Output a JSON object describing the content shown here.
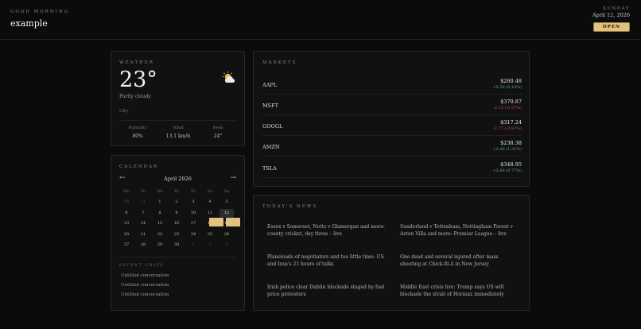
{
  "header": {
    "greeting": "GOOD MORNING",
    "name": "example",
    "day": "SUNDAY",
    "date": "April 12, 2026",
    "open_chat_label": "OPEN CHAT",
    "accent_color": "#e3c27d"
  },
  "weather": {
    "title": "WEATHER",
    "temperature": "23°",
    "condition": "Partly cloudy",
    "city": "City",
    "icon": "partly-cloudy-icon",
    "stats": [
      {
        "label": "Humidity",
        "value": "80%"
      },
      {
        "label": "Wind",
        "value": "13.1 km/h"
      },
      {
        "label": "Feels",
        "value": "24°"
      }
    ]
  },
  "calendar": {
    "title": "CALENDAR",
    "month": "April 2026",
    "prev_icon": "←",
    "next_icon": "→",
    "weekdays": [
      "Mo",
      "Tu",
      "We",
      "Th",
      "Fr",
      "Sa",
      "Su"
    ],
    "days": [
      [
        "30",
        "31",
        "1",
        "2",
        "3",
        "4",
        "5"
      ],
      [
        "6",
        "7",
        "8",
        "9",
        "10",
        "11",
        "12"
      ],
      [
        "13",
        "14",
        "15",
        "16",
        "17",
        "18",
        "19"
      ],
      [
        "20",
        "21",
        "22",
        "23",
        "24",
        "25",
        "26"
      ],
      [
        "27",
        "28",
        "29",
        "30",
        "1",
        "2",
        "3"
      ]
    ],
    "selected_day": "12",
    "event_days": [
      "11",
      "12"
    ],
    "recent_title": "RECENT CHATS",
    "recent_chats": [
      "Untitled conversation",
      "Untitled conversation",
      "Untitled conversation"
    ]
  },
  "markets": {
    "title": "MARKETS",
    "up_color": "#5cb66a",
    "down_color": "#d0544a",
    "stocks": [
      {
        "ticker": "AAPL",
        "price": "$260.48",
        "change": "+0.50 (0.19%)",
        "direction": "up"
      },
      {
        "ticker": "MSFT",
        "price": "$370.87",
        "change": "-2.13 (-0.57%)",
        "direction": "down"
      },
      {
        "ticker": "GOOGL",
        "price": "$317.24",
        "change": "-2.77 (-0.87%)",
        "direction": "down"
      },
      {
        "ticker": "AMZN",
        "price": "$238.38",
        "change": "+3.00 (1.31%)",
        "direction": "up"
      },
      {
        "ticker": "TSLA",
        "price": "$348.95",
        "change": "+2.66 (0.77%)",
        "direction": "up"
      }
    ]
  },
  "news": {
    "title": "TODAY'S NEWS",
    "items": [
      "Essex v Somerset, Notts v Glamorgan and more: county cricket, day three – live",
      "Sunderland v Tottenham, Nottingham Forest v Aston Villa and more: Premier League – live",
      "Planeloads of negotiators and too little time: US and Iran's 21 hours of talks",
      "One dead and several injured after mass shooting at Chick-fil-A in New Jersey",
      "Irish police clear Dublin blockade staged by fuel price protesters",
      "Middle East crisis live: Trump says US will blockade the strait of Hormuz immediately"
    ]
  }
}
